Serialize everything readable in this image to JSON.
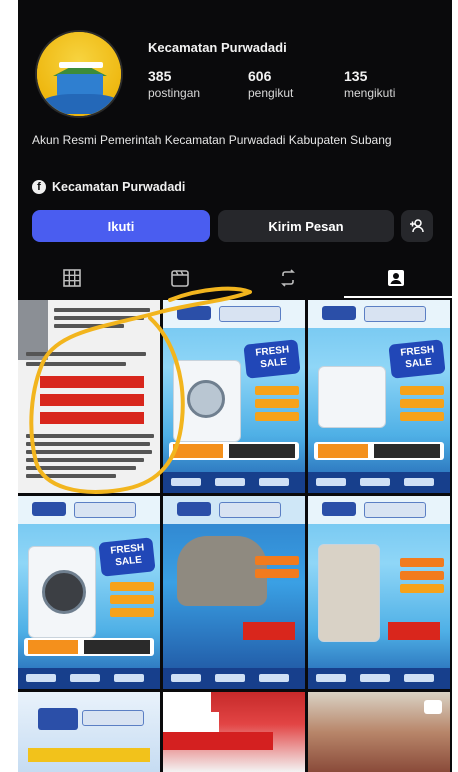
{
  "profile": {
    "name": "Kecamatan Purwadadi",
    "stats": [
      {
        "value": "385",
        "label": "postingan"
      },
      {
        "value": "606",
        "label": "pengikut"
      },
      {
        "value": "135",
        "label": "mengikuti"
      }
    ],
    "bio": "Akun Resmi Pemerintah Kecamatan Purwadadi Kabupaten Subang",
    "facebook_link": "Kecamatan Purwadadi"
  },
  "actions": {
    "follow_label": "Ikuti",
    "message_label": "Kirim Pesan"
  },
  "tabs": [
    {
      "name": "grid",
      "icon": "grid-icon",
      "active": false
    },
    {
      "name": "reels",
      "icon": "calendar-icon",
      "active": false
    },
    {
      "name": "reposts",
      "icon": "repost-icon",
      "active": false
    },
    {
      "name": "tagged",
      "icon": "person-tag-icon",
      "active": true
    }
  ],
  "colors": {
    "background": "#0a0a0c",
    "follow_button": "#4a5df0",
    "secondary_button": "#26272b",
    "annotation_scribble": "#f2b51e"
  },
  "posts": {
    "rows": 3,
    "columns": 3,
    "promo_badge": "FRESH SALE"
  }
}
